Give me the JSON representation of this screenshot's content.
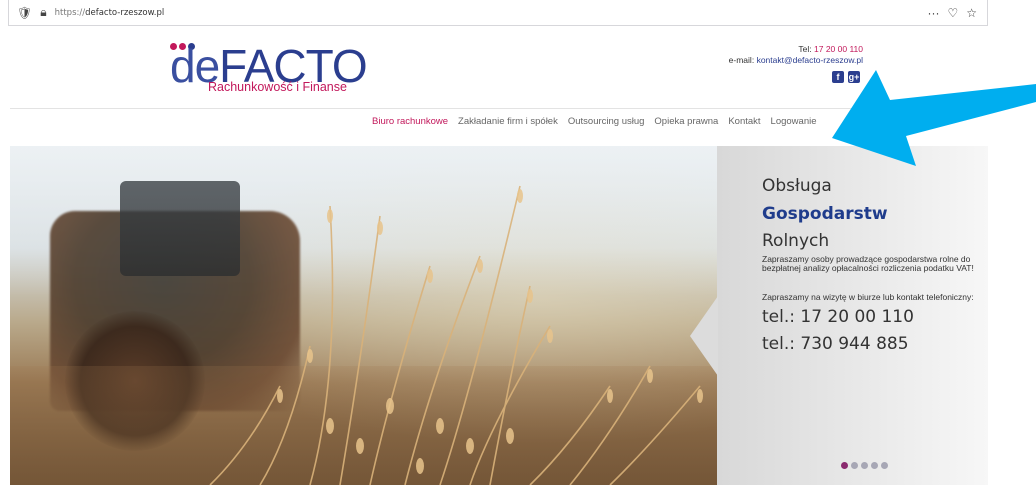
{
  "browser": {
    "url_prefix": "https://",
    "url_host": "defacto-rzeszow.pl",
    "menu_label": "···"
  },
  "brand": {
    "logo_de": "de",
    "logo_facto": "FACTO",
    "tagline": "Rachunkowość i Finanse"
  },
  "contact": {
    "tel_label": "Tel:",
    "tel_value": "17 20 00 110",
    "email_label": "e-mail:",
    "email_value": "kontakt@defacto-rzeszow.pl",
    "facebook_glyph": "f",
    "googleplus_glyph": "g+"
  },
  "nav": {
    "items": [
      {
        "label": "Biuro rachunkowe",
        "active": true
      },
      {
        "label": "Zakładanie firm i spółek"
      },
      {
        "label": "Outsourcing usług"
      },
      {
        "label": "Opieka prawna"
      },
      {
        "label": "Kontakt"
      },
      {
        "label": "Logowanie"
      }
    ]
  },
  "hero": {
    "title_line1": "Obsługa",
    "title_line2": "Gospodarstw",
    "title_line3": "Rolnych",
    "paragraph1": "Zapraszamy osoby prowadzące gospodarstwa rolne do bezpłatnej analizy opłacalności rozliczenia podatku VAT!",
    "paragraph2": "Zapraszamy na wizytę w biurze lub kontakt telefoniczny:",
    "tel1": "tel.: 17 20 00 110",
    "tel2": "tel.: 730 944 885",
    "slides_total": 5,
    "slide_active": 1
  },
  "colors": {
    "brand_blue": "#2b3e8f",
    "accent_pink": "#c2185b",
    "annotation_arrow": "#00aeef"
  }
}
